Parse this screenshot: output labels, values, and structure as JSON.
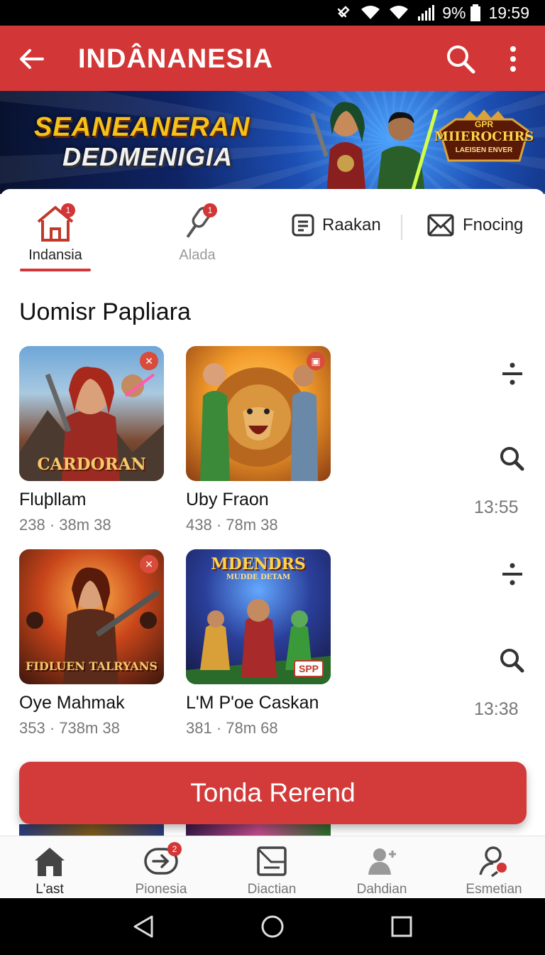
{
  "status_bar": {
    "battery": "9%",
    "time": "19:59"
  },
  "app_bar": {
    "title": "INDÂNANESIA",
    "back_icon": "arrow-left-icon",
    "search_icon": "search-icon",
    "more_icon": "more-vertical-icon"
  },
  "banner": {
    "line1": "SEANEANERAN",
    "line2": "DEDMENIGIA",
    "logo_top": "GPR",
    "logo_mid": "MIIEROCHRS",
    "logo_bottom": "LAEISEN ENVER"
  },
  "tabs": [
    {
      "label": "Indansia",
      "icon": "home-icon",
      "badge": "1",
      "active": true
    },
    {
      "label": "Alada",
      "icon": "microphone-icon",
      "badge": "1",
      "active": false
    },
    {
      "label": "Raakan",
      "icon": "document-icon"
    },
    {
      "label": "Fnocing",
      "icon": "mail-icon"
    }
  ],
  "section_title": "Uomisr Papliara",
  "games": [
    {
      "name": "Fluþllam",
      "meta": "238 · 38m 38",
      "thumb_text": "CARDORAN"
    },
    {
      "name": "Uby Fraon",
      "meta": "438 · 78m 38",
      "thumb_text": ""
    },
    {
      "name": "Oye Mahmak",
      "meta": "353 · 738m 38",
      "thumb_text": "FIDLUEN TALRYANS"
    },
    {
      "name": "L'M P'oe Caskan",
      "meta": "381 · 78m 68",
      "thumb_text": "MDENDRS",
      "thumb_sub": "MUDDE DETAM",
      "thumb_tag": "SPP"
    }
  ],
  "side_times": [
    "13:55",
    "13:38"
  ],
  "cta": {
    "label": "Tonda Rerend"
  },
  "bottom_nav": [
    {
      "label": "L'ast",
      "icon": "home-icon",
      "active": true
    },
    {
      "label": "Pionesia",
      "icon": "arrow-right-circle-icon",
      "badge": "2"
    },
    {
      "label": "Diactian",
      "icon": "document-icon"
    },
    {
      "label": "Dahdian",
      "icon": "add-user-icon"
    },
    {
      "label": "Esmetian",
      "icon": "user-search-icon"
    }
  ],
  "colors": {
    "primary": "#d33636",
    "text_secondary": "#777777"
  }
}
